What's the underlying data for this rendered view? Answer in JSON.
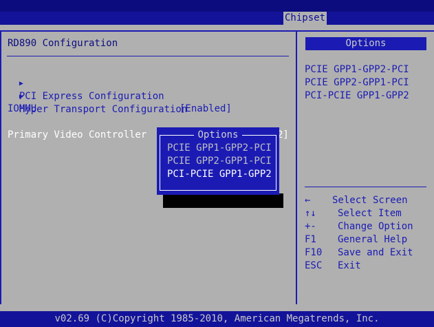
{
  "header": {
    "active_tab": "Chipset"
  },
  "main": {
    "title": "RD890 Configuration",
    "submenus": [
      {
        "arrow": "▶",
        "label": "PCI Express Configuration"
      },
      {
        "arrow": "▶",
        "label": "Hyper Transport Configuration"
      }
    ],
    "settings": [
      {
        "label": "IOMMU",
        "value": "[Enabled]"
      },
      {
        "label": "Primary Video Controller",
        "value": "2]"
      }
    ]
  },
  "side": {
    "header": "Options",
    "options": [
      "PCIE GPP1-GPP2-PCI",
      "PCIE GPP2-GPP1-PCI",
      "PCI-PCIE GPP1-GPP2"
    ],
    "help": [
      {
        "key": "←",
        "desc": "Select Screen"
      },
      {
        "key": "↑↓",
        "desc": "Select Item"
      },
      {
        "key": "+-",
        "desc": "Change Option"
      },
      {
        "key": "F1",
        "desc": "General Help"
      },
      {
        "key": "F10",
        "desc": "Save and Exit"
      },
      {
        "key": "ESC",
        "desc": "Exit"
      }
    ]
  },
  "popup": {
    "title": "Options",
    "items": [
      "PCIE GPP1-GPP2-PCI",
      "PCIE GPP2-GPP1-PCI",
      "PCI-PCIE GPP1-GPP2"
    ],
    "selected_index": 2
  },
  "footer": {
    "text": "v02.69 (C)Copyright 1985-2010, American Megatrends, Inc."
  },
  "colors": {
    "background": "#b0b0b0",
    "accent": "#1b1bb4",
    "bar": "#13139a",
    "highlight_text": "#ffffff"
  }
}
